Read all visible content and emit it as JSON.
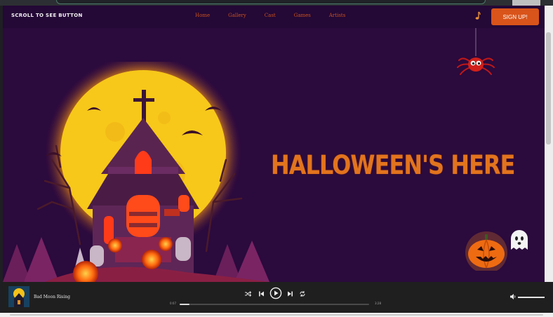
{
  "navbar": {
    "brand": "SCROLL TO SEE BUTTON",
    "links": [
      "Home",
      "Gallery",
      "Cast",
      "Games",
      "Artists"
    ],
    "signup_label": "SIGN UP!"
  },
  "hero": {
    "headline": "HALLOWEEN'S HERE"
  },
  "player": {
    "track_title": "Bad Moon Rising",
    "current_time": "0:07",
    "end_time": "3:28",
    "progress": 0.05,
    "volume": 1.0,
    "controls": [
      "shuffle-icon",
      "previous-icon",
      "play-icon",
      "next-icon",
      "repeat-icon"
    ]
  },
  "colors": {
    "background": "#2b0a3d",
    "navbar": "#240836",
    "accent": "#d9541a",
    "headline": "#e2741e",
    "nav_link": "#c8531f",
    "moon": "#f2c21a",
    "player_bg": "#1f1f1f"
  },
  "icons": {
    "music": "music-note-icon",
    "volume": "volume-icon"
  }
}
